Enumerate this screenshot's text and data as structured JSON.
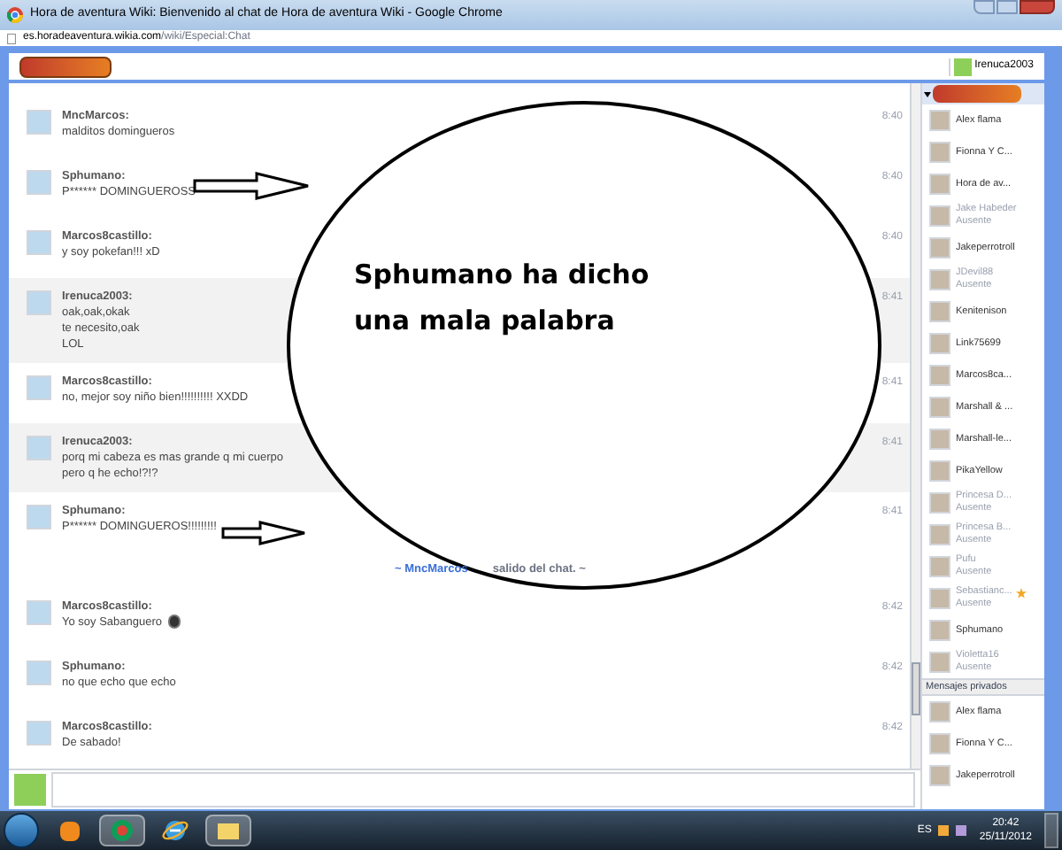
{
  "window": {
    "title": "Hora de aventura Wiki: Bienvenido al chat de Hora de aventura Wiki - Google Chrome",
    "url_host": "es.horadeaventura.wikia.com",
    "url_path": "/wiki/Especial:Chat"
  },
  "header": {
    "user": "Irenuca2003"
  },
  "messages": [
    {
      "kind": "message",
      "user": "MncMarcos:",
      "lines": [
        "malditos domingueros"
      ],
      "time": "8:40",
      "own": false
    },
    {
      "kind": "message",
      "user": "Sphumano:",
      "lines": [
        "P****** DOMINGUEROSS"
      ],
      "time": "8:40",
      "own": false
    },
    {
      "kind": "message",
      "user": "Marcos8castillo:",
      "lines": [
        "y soy pokefan!!! xD"
      ],
      "time": "8:40",
      "own": false
    },
    {
      "kind": "message",
      "user": "Irenuca2003:",
      "lines": [
        "oak,oak,okak",
        "te necesito,oak",
        "LOL"
      ],
      "time": "8:41",
      "own": true
    },
    {
      "kind": "message",
      "user": "Marcos8castillo:",
      "lines": [
        "no, mejor soy niño bien!!!!!!!!!! XXDD"
      ],
      "time": "8:41",
      "own": false
    },
    {
      "kind": "message",
      "user": "Irenuca2003:",
      "lines": [
        "porq mi cabeza es mas grande q mi cuerpo",
        "pero q he echo!?!?"
      ],
      "time": "8:41",
      "own": true
    },
    {
      "kind": "message",
      "user": "Sphumano:",
      "lines": [
        "P****** DOMINGUEROS!!!!!!!!!"
      ],
      "time": "8:41",
      "own": false
    },
    {
      "kind": "inline",
      "before": "~ MncMarcos",
      "after": "salido del chat. ~"
    },
    {
      "kind": "message",
      "user": "Marcos8castillo:",
      "lines": [
        "Yo soy Sabanguero"
      ],
      "emoticon": true,
      "time": "8:42",
      "own": false
    },
    {
      "kind": "message",
      "user": "Sphumano:",
      "lines": [
        "no que echo que echo"
      ],
      "time": "8:42",
      "own": false
    },
    {
      "kind": "message",
      "user": "Marcos8castillo:",
      "lines": [
        "De sabado!"
      ],
      "time": "8:42",
      "own": false
    }
  ],
  "annotation": {
    "text": "Sphumano ha dicho una mala palabra"
  },
  "users": [
    {
      "name": "Alex flama",
      "away": false,
      "starred": false
    },
    {
      "name": "Fionna Y C...",
      "away": false,
      "starred": false
    },
    {
      "name": "Hora de av...",
      "away": false,
      "starred": false
    },
    {
      "name": "Jake Habeder",
      "status": "Ausente",
      "away": true,
      "starred": false
    },
    {
      "name": "Jakeperrotroll",
      "away": false,
      "starred": false
    },
    {
      "name": "JDevil88",
      "status": "Ausente",
      "away": true,
      "starred": false
    },
    {
      "name": "Kenitenison",
      "away": false,
      "starred": false
    },
    {
      "name": "Link75699",
      "away": false,
      "starred": false
    },
    {
      "name": "Marcos8ca...",
      "away": false,
      "starred": false
    },
    {
      "name": "Marshall & ...",
      "away": false,
      "starred": false
    },
    {
      "name": "Marshall-le...",
      "away": false,
      "starred": false
    },
    {
      "name": "PikaYellow",
      "away": false,
      "starred": false
    },
    {
      "name": "Princesa D...",
      "status": "Ausente",
      "away": true,
      "starred": false
    },
    {
      "name": "Princesa B...",
      "status": "Ausente",
      "away": true,
      "starred": false
    },
    {
      "name": "Pufu",
      "status": "Ausente",
      "away": true,
      "starred": false
    },
    {
      "name": "Sebastianc...",
      "status": "Ausente",
      "away": true,
      "starred": true
    },
    {
      "name": "Sphumano",
      "away": false,
      "starred": false
    },
    {
      "name": "Violetta16",
      "status": "Ausente",
      "away": true,
      "starred": false
    }
  ],
  "private_header": "Mensajes privados",
  "private_users": [
    {
      "name": "Alex flama"
    },
    {
      "name": "Fionna Y C..."
    },
    {
      "name": "Jakeperrotroll"
    }
  ],
  "taskbar": {
    "language": "ES",
    "time": "20:42",
    "date": "25/11/2012"
  }
}
